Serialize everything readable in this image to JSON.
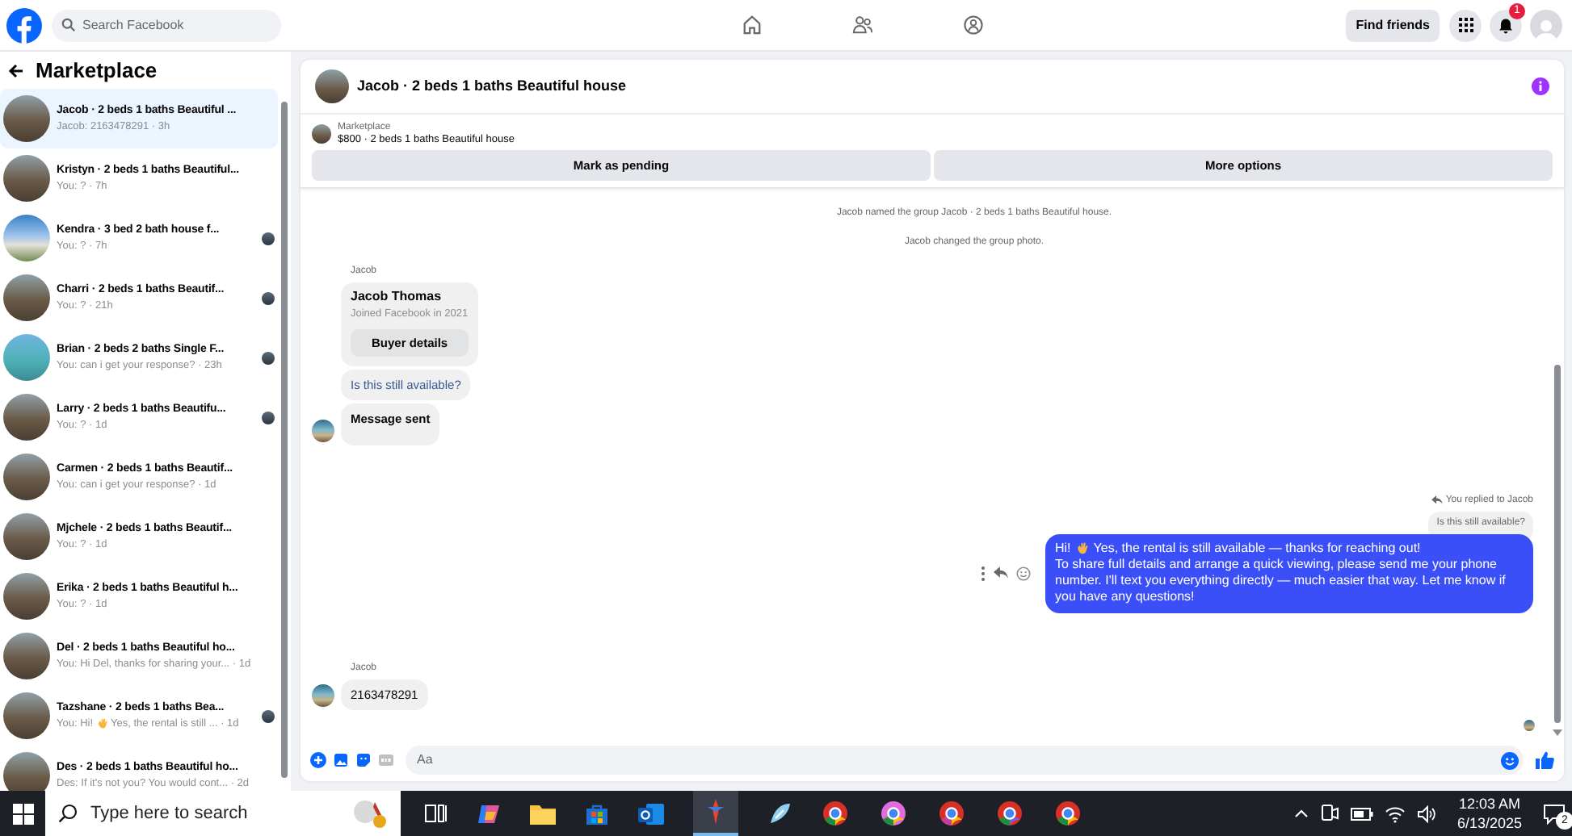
{
  "top_bar": {
    "search_placeholder": "Search Facebook",
    "find_friends": "Find friends",
    "notification_count": "1"
  },
  "sidebar": {
    "title": "Marketplace",
    "conversations": [
      {
        "title": "Jacob · 2 beds 1 baths Beautiful ...",
        "subtitle": "Jacob: 2163478291 · 3h",
        "selected": true,
        "read_receipt": false
      },
      {
        "title": "Kristyn · 2 beds 1 baths Beautiful...",
        "subtitle": "You: ? · 7h",
        "selected": false,
        "read_receipt": false
      },
      {
        "title": "Kendra · 3 bed 2 bath house f...",
        "subtitle": "You: ? · 7h",
        "selected": false,
        "read_receipt": true
      },
      {
        "title": "Charri · 2 beds 1 baths Beautif...",
        "subtitle": "You: ? · 21h",
        "selected": false,
        "read_receipt": true
      },
      {
        "title": "Brian · 2 beds 2 baths Single F...",
        "subtitle": "You: can i get your response? · 23h",
        "selected": false,
        "read_receipt": true
      },
      {
        "title": "Larry · 2 beds 1 baths Beautifu...",
        "subtitle": "You: ? · 1d",
        "selected": false,
        "read_receipt": true
      },
      {
        "title": "Carmen · 2 beds 1 baths Beautif...",
        "subtitle": "You: can i get your response? · 1d",
        "selected": false,
        "read_receipt": false
      },
      {
        "title": "Mjchele · 2 beds 1 baths Beautif...",
        "subtitle": "You: ? · 1d",
        "selected": false,
        "read_receipt": false
      },
      {
        "title": "Erika · 2 beds 1 baths Beautiful h...",
        "subtitle": "You: ? · 1d",
        "selected": false,
        "read_receipt": false
      },
      {
        "title": "Del · 2 beds 1 baths Beautiful ho...",
        "subtitle": "You: Hi Del, thanks for sharing your... · 1d",
        "selected": false,
        "read_receipt": false
      },
      {
        "title": "Tazshane · 2 beds 1 baths Bea...",
        "subtitle": "You: Hi!",
        "subtitle_after_emoji": "Yes, the rental is still ... · 1d",
        "selected": false,
        "read_receipt": true
      },
      {
        "title": "Des · 2 beds 1 baths Beautiful ho...",
        "subtitle": "Des: If it's not you? You would cont... · 2d",
        "selected": false,
        "read_receipt": false
      }
    ]
  },
  "chat": {
    "title": "Jacob · 2 beds 1 baths Beautiful house",
    "listing": {
      "label": "Marketplace",
      "text": "$800 · 2 beds 1 baths Beautiful house"
    },
    "actions": [
      "Mark as pending",
      "More options"
    ],
    "events": [
      "Jacob named the group Jacob · 2 beds 1 baths Beautiful house.",
      "Jacob changed the group photo."
    ],
    "first_group": {
      "sender": "Jacob",
      "card": {
        "name": "Jacob Thomas",
        "joined": "Joined Facebook in 2021",
        "button": "Buyer details"
      },
      "messages": [
        "Is this still available?",
        "Message sent"
      ]
    },
    "reply": {
      "note": "You replied to Jacob",
      "quoted": "Is this still available?",
      "greeting": "Hi!",
      "first_line": "Yes, the rental is still available — thanks for reaching out!",
      "body": "To share full details and arrange a quick viewing, please send me your phone number. I'll text you everything directly — much easier that way. Let me know if you have any questions!"
    },
    "second_group": {
      "sender": "Jacob",
      "messages": [
        "2163478291"
      ]
    },
    "composer": {
      "placeholder": "Aa"
    }
  },
  "taskbar": {
    "search_placeholder": "Type here to search",
    "time": "12:03 AM",
    "date": "6/13/2025",
    "notification_count": "2"
  }
}
